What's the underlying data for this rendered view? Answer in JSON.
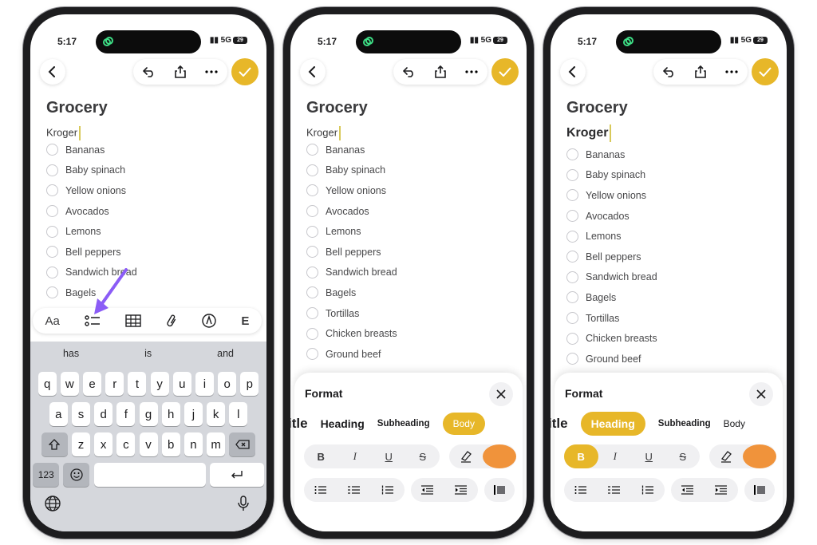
{
  "colors": {
    "accent": "#e7b729",
    "arrow": "#8b5cf6",
    "dot": "#f0933b"
  },
  "status": {
    "time": "5:17",
    "network": "5G",
    "battery": "29"
  },
  "note": {
    "title": "Grocery",
    "store": "Kroger",
    "items": [
      "Bananas",
      "Baby spinach",
      "Yellow onions",
      "Avocados",
      "Lemons",
      "Bell peppers",
      "Sandwich bread",
      "Bagels",
      "Tortillas",
      "Chicken breasts",
      "Ground beef"
    ]
  },
  "toolbar": {
    "text_style": "Aa"
  },
  "keyboard": {
    "suggestions": [
      "has",
      "is",
      "and"
    ],
    "row1": [
      "q",
      "w",
      "e",
      "r",
      "t",
      "y",
      "u",
      "i",
      "o",
      "p"
    ],
    "row2": [
      "a",
      "s",
      "d",
      "f",
      "g",
      "h",
      "j",
      "k",
      "l"
    ],
    "row3": [
      "z",
      "x",
      "c",
      "v",
      "b",
      "n",
      "m"
    ],
    "numbers_key": "123"
  },
  "format": {
    "title": "Format",
    "styles": {
      "title": "Title",
      "title_visible": "itle",
      "heading": "Heading",
      "subheading": "Subheading",
      "body": "Body"
    },
    "text": {
      "bold": "B",
      "italic": "I",
      "underline": "U",
      "strike": "S"
    }
  }
}
